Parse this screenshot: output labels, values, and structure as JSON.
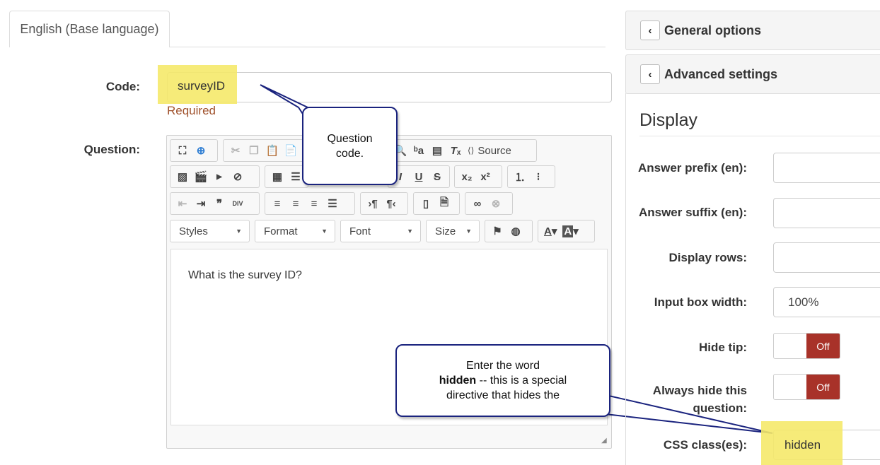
{
  "tab": {
    "label": "English (Base language)"
  },
  "code": {
    "label": "Code:",
    "value": "surveyID",
    "required": "Required"
  },
  "question": {
    "label": "Question:",
    "text": "What is the survey ID?",
    "toolbar": {
      "source_label": "Source",
      "styles": "Styles",
      "format": "Format",
      "font": "Font",
      "size": "Size"
    }
  },
  "callouts": {
    "code_tip": {
      "line1": "Question",
      "line2": "code."
    },
    "hidden_tip": {
      "line1": "Enter the word",
      "line2_bold": "hidden",
      "line2_rest": " -- this is a special",
      "line3": "directive that hides the"
    }
  },
  "sidebar": {
    "general_options": "General options",
    "advanced_settings": "Advanced settings",
    "display_heading": "Display",
    "fields": {
      "answer_prefix": "Answer prefix (en):",
      "answer_suffix": "Answer suffix (en):",
      "display_rows": "Display rows:",
      "input_box_width": "Input box width:",
      "input_box_width_value": "100%",
      "hide_tip": "Hide tip:",
      "hide_tip_state": "Off",
      "always_hide_line1": "Always hide this",
      "always_hide_line2": "question:",
      "always_hide_state": "Off",
      "css_class": "CSS class(es):",
      "css_class_value": "hidden"
    }
  },
  "colors": {
    "highlight": "#f5e96a",
    "toggle_off": "#a83229",
    "callout_border": "#1a237e",
    "required": "#a0522d"
  }
}
